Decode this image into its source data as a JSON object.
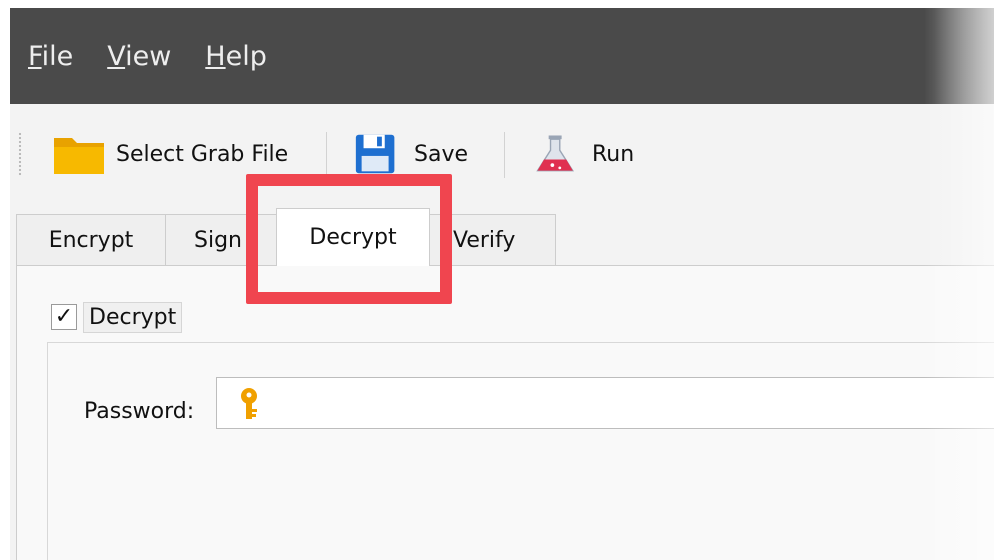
{
  "menu": {
    "items": [
      {
        "label": "File",
        "mnemonic": "F",
        "rest": "ile"
      },
      {
        "label": "View",
        "mnemonic": "V",
        "rest": "iew"
      },
      {
        "label": "Help",
        "mnemonic": "H",
        "rest": "elp"
      }
    ]
  },
  "toolbar": {
    "select_grab_file": {
      "label": "Select Grab File",
      "icon": "folder-icon"
    },
    "save": {
      "label": "Save",
      "icon": "floppy-disk-icon"
    },
    "run": {
      "label": "Run",
      "icon": "flask-icon"
    }
  },
  "tabs": [
    {
      "label": "Encrypt",
      "active": false
    },
    {
      "label": "Sign",
      "active": false
    },
    {
      "label": "Decrypt",
      "active": true
    },
    {
      "label": "Verify",
      "active": false
    }
  ],
  "decrypt_panel": {
    "checkbox_label": "Decrypt",
    "checkbox_checked": true,
    "checkmark": "✓",
    "password_label": "Password:",
    "password_value": "",
    "password_icon": "key-icon"
  },
  "colors": {
    "highlight": "#f0454f",
    "menubar_bg": "#4a4a4a",
    "folder": "#f5b400",
    "floppy": "#1e6fd0",
    "flask": "#e03050",
    "key": "#f0a000"
  }
}
